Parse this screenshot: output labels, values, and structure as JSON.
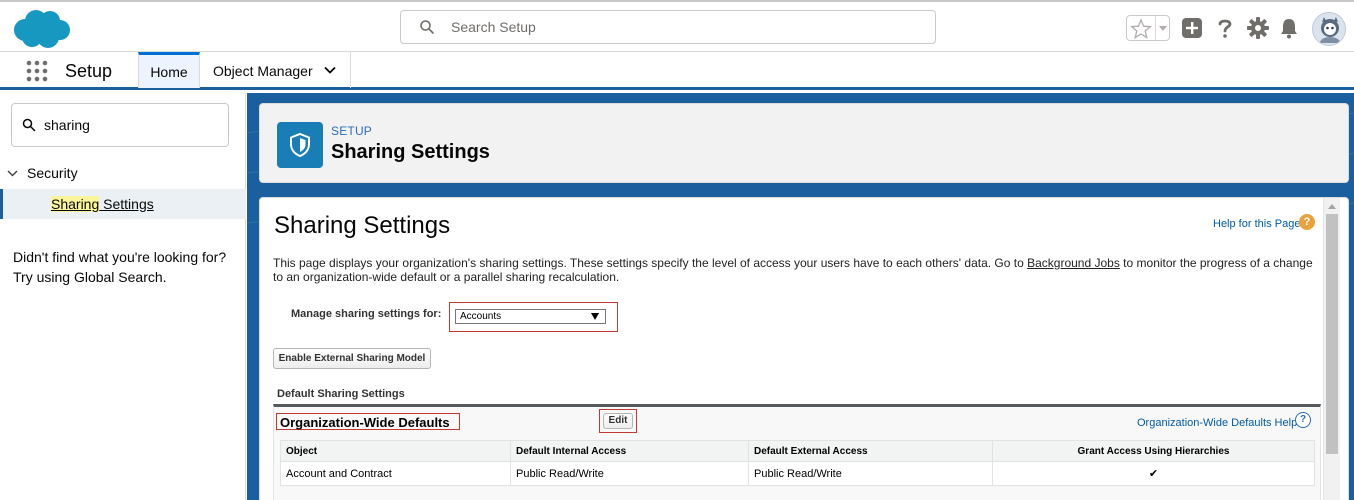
{
  "header": {
    "search_placeholder": "Search Setup",
    "icons": [
      "salesforce-cloud-logo",
      "search-icon",
      "star-icon",
      "add-icon",
      "help-icon",
      "gear-icon",
      "bell-icon",
      "avatar"
    ],
    "brand_color": "#1798c1"
  },
  "context_bar": {
    "app_name": "Setup",
    "tabs": [
      {
        "label": "Home",
        "active": true
      },
      {
        "label": "Object Manager",
        "active": false
      }
    ]
  },
  "left_panel": {
    "quickfind_value": "sharing",
    "tree_parent": "Security",
    "tree_child_highlight": "Sharing",
    "tree_child_rest": " Settings",
    "not_found_line1": "Didn't find what you're looking for?",
    "not_found_line2": "Try using Global Search."
  },
  "page_header": {
    "eyebrow": "SETUP",
    "title": "Sharing Settings"
  },
  "content": {
    "title": "Sharing Settings",
    "help_link": "Help for this Page",
    "description_part1": "This page displays your organization's sharing settings. These settings specify the level of access your users have to each others' data. Go to ",
    "description_link": "Background Jobs",
    "description_part2": " to monitor the progress of a change to an organization-wide default or a parallel sharing recalculation.",
    "manage_label": "Manage sharing settings for:",
    "manage_value": "Accounts",
    "enable_external_button": "Enable External Sharing Model",
    "section_title": "Default Sharing Settings",
    "owd": {
      "title": "Organization-Wide Defaults",
      "edit_button": "Edit",
      "help_link": "Organization-Wide Defaults Help",
      "columns": [
        "Object",
        "Default Internal Access",
        "Default External Access",
        "Grant Access Using Hierarchies"
      ],
      "rows": [
        {
          "object": "Account and Contract",
          "internal": "Public Read/Write",
          "external": "Public Read/Write",
          "grant": "✔"
        }
      ]
    }
  }
}
